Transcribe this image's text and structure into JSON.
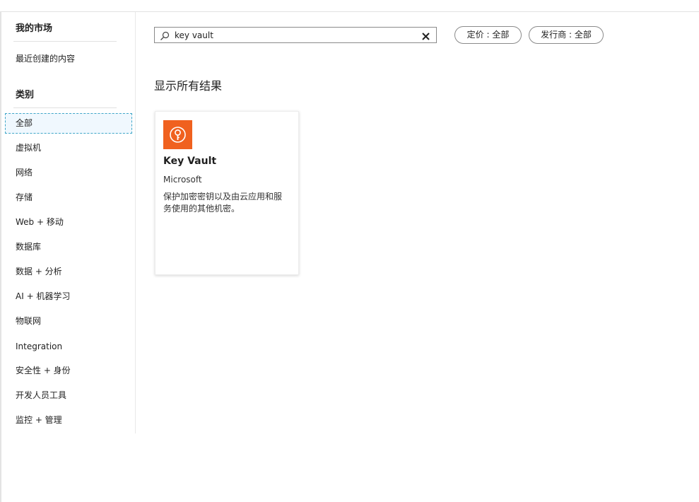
{
  "sidebar": {
    "my_market": "我的市场",
    "recent": "最近创建的内容",
    "categories_heading": "类别",
    "categories": [
      "全部",
      "虚拟机",
      "网络",
      "存储",
      "Web + 移动",
      "数据库",
      "数据 + 分析",
      "AI + 机器学习",
      "物联网",
      "Integration",
      "安全性 + 身份",
      "开发人员工具",
      "监控 + 管理"
    ],
    "selected_index": 0
  },
  "search": {
    "value": "key vault"
  },
  "filters": {
    "pricing": "定价 : 全部",
    "publisher": "发行商 : 全部"
  },
  "results": {
    "title": "显示所有结果",
    "items": [
      {
        "name": "Key Vault",
        "publisher": "Microsoft",
        "description": "保护加密密钥以及由云应用和服务使用的其他机密。",
        "icon": "key-vault-icon",
        "icon_color": "#f0611f"
      }
    ]
  },
  "colors": {
    "selected_bg": "#f0f8fe",
    "selected_border": "#3fa6c8"
  }
}
